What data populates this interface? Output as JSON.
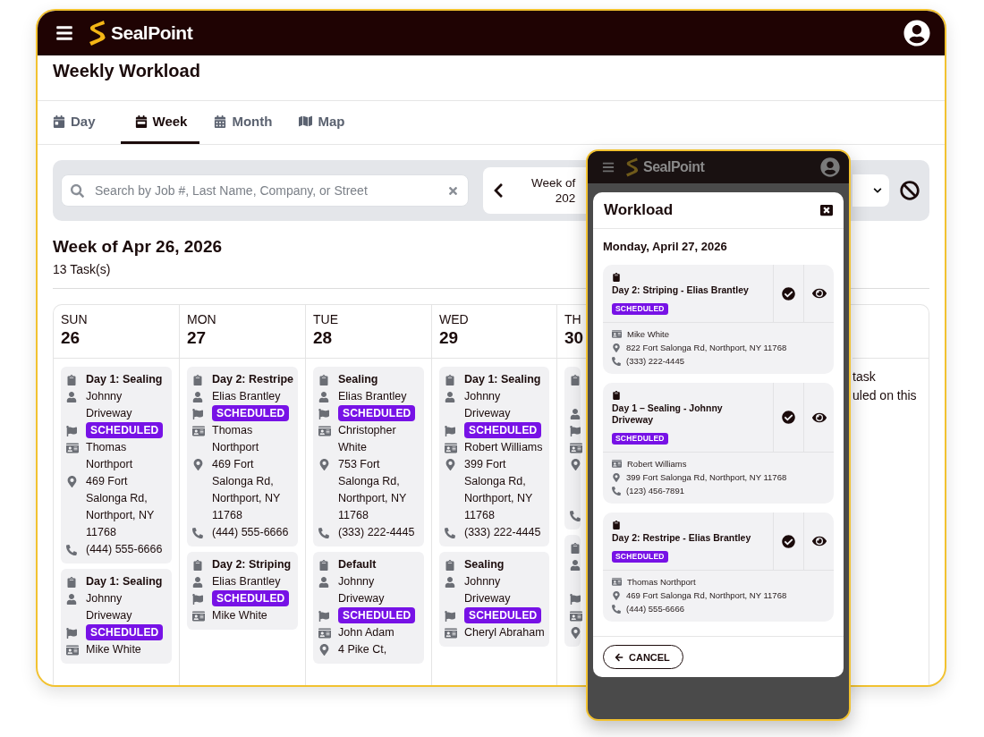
{
  "app_bar": {
    "brand": "SealPoint"
  },
  "page_title": "Weekly Workload",
  "tabs": [
    {
      "label": "Day",
      "kind": "day",
      "selected": false
    },
    {
      "label": "Week",
      "kind": "week",
      "selected": true
    },
    {
      "label": "Month",
      "kind": "month",
      "selected": false
    },
    {
      "label": "Map",
      "kind": "map",
      "selected": false
    }
  ],
  "search": {
    "placeholder": "Search by Job #, Last Name, Company, or Street"
  },
  "week_nav": {
    "lines": [
      "Week of",
      "202"
    ]
  },
  "week_heading": "Week of Apr 26, 2026",
  "task_count": "13 Task(s)",
  "days": [
    {
      "weekday": "SUN",
      "date": "26",
      "tasks": [
        {
          "rows": [
            {
              "kind": "title",
              "text": "Day 1: Sealing"
            },
            {
              "kind": "person",
              "text": "Johnny Driveway"
            },
            {
              "kind": "status",
              "text": "SCHEDULED"
            },
            {
              "kind": "customer",
              "text": "Thomas Northport"
            },
            {
              "kind": "address",
              "text": "469 Fort Salonga Rd, Northport, NY 11768"
            },
            {
              "kind": "phone",
              "text": "(444) 555-6666"
            }
          ]
        },
        {
          "rows": [
            {
              "kind": "title",
              "text": "Day 1: Sealing"
            },
            {
              "kind": "person",
              "text": "Johnny Driveway"
            },
            {
              "kind": "status",
              "text": "SCHEDULED"
            },
            {
              "kind": "customer",
              "text": "Mike White"
            }
          ]
        }
      ]
    },
    {
      "weekday": "MON",
      "date": "27",
      "tasks": [
        {
          "rows": [
            {
              "kind": "title",
              "text": "Day 2: Restripe"
            },
            {
              "kind": "person",
              "text": "Elias Brantley"
            },
            {
              "kind": "status",
              "text": "SCHEDULED"
            },
            {
              "kind": "customer",
              "text": "Thomas Northport"
            },
            {
              "kind": "address",
              "text": "469 Fort Salonga Rd, Northport, NY 11768"
            },
            {
              "kind": "phone",
              "text": "(444) 555-6666"
            }
          ]
        },
        {
          "rows": [
            {
              "kind": "title",
              "text": "Day 2: Striping"
            },
            {
              "kind": "person",
              "text": "Elias Brantley"
            },
            {
              "kind": "status",
              "text": "SCHEDULED"
            },
            {
              "kind": "customer",
              "text": "Mike White"
            }
          ]
        }
      ]
    },
    {
      "weekday": "TUE",
      "date": "28",
      "tasks": [
        {
          "rows": [
            {
              "kind": "title",
              "text": "Sealing"
            },
            {
              "kind": "person",
              "text": "Elias Brantley"
            },
            {
              "kind": "status",
              "text": "SCHEDULED"
            },
            {
              "kind": "customer",
              "text": "Christopher White"
            },
            {
              "kind": "address",
              "text": "753 Fort Salonga Rd, Northport, NY 11768"
            },
            {
              "kind": "phone",
              "text": "(333) 222-4445"
            }
          ]
        },
        {
          "rows": [
            {
              "kind": "title",
              "text": "Default"
            },
            {
              "kind": "person",
              "text": "Johnny Driveway"
            },
            {
              "kind": "status",
              "text": "SCHEDULED"
            },
            {
              "kind": "customer",
              "text": "John Adam"
            },
            {
              "kind": "address",
              "text": "4 Pike Ct,"
            }
          ]
        }
      ]
    },
    {
      "weekday": "WED",
      "date": "29",
      "tasks": [
        {
          "rows": [
            {
              "kind": "title",
              "text": "Day 1: Sealing"
            },
            {
              "kind": "person",
              "text": "Johnny Driveway"
            },
            {
              "kind": "status",
              "text": "SCHEDULED"
            },
            {
              "kind": "customer",
              "text": "Robert Williams"
            },
            {
              "kind": "address",
              "text": "399 Fort Salonga Rd, Northport, NY 11768"
            },
            {
              "kind": "phone",
              "text": "(333) 222-4445"
            }
          ]
        },
        {
          "rows": [
            {
              "kind": "title",
              "text": "Sealing"
            },
            {
              "kind": "person",
              "text": "Johnny Driveway"
            },
            {
              "kind": "status",
              "text": "SCHEDULED"
            },
            {
              "kind": "customer",
              "text": "Cheryl Abraham"
            }
          ]
        }
      ]
    },
    {
      "weekday": "TH",
      "date": "30",
      "tasks": [
        {
          "rows": [
            {
              "kind": "title"
            },
            {
              "kind": "gap"
            },
            {
              "kind": "person"
            },
            {
              "kind": "status"
            },
            {
              "kind": "customer"
            },
            {
              "kind": "address"
            },
            {
              "kind": "gap"
            },
            {
              "kind": "gap"
            },
            {
              "kind": "phone"
            }
          ]
        },
        {
          "rows": [
            {
              "kind": "title"
            },
            {
              "kind": "person"
            },
            {
              "kind": "gap"
            },
            {
              "kind": "status"
            },
            {
              "kind": "customer"
            },
            {
              "kind": "address"
            }
          ]
        }
      ]
    }
  ],
  "side_note_lines": [
    "task",
    "uled on this"
  ],
  "mobile": {
    "brand": "SealPoint",
    "modal": {
      "title": "Workload",
      "date": "Monday, April 27, 2026",
      "tasks": [
        {
          "title": "Day 2: Striping - Elias Brantley",
          "status": "SCHEDULED",
          "customer": "Mike White",
          "address": "822 Fort Salonga Rd, Northport, NY 11768",
          "phone": "(333) 222-4445"
        },
        {
          "title": "Day 1 – Sealing - Johnny Driveway",
          "status": "SCHEDULED",
          "customer": "Robert Williams",
          "address": "399 Fort Salonga Rd, Northport, NY 11768",
          "phone": "(123) 456-7891"
        },
        {
          "title": "Day 2: Restripe - Elias Brantley",
          "status": "SCHEDULED",
          "customer": "Thomas Northport",
          "address": "469 Fort Salonga Rd, Northport, NY 11768",
          "phone": "(444) 555-6666"
        }
      ],
      "cancel": "CANCEL"
    }
  }
}
